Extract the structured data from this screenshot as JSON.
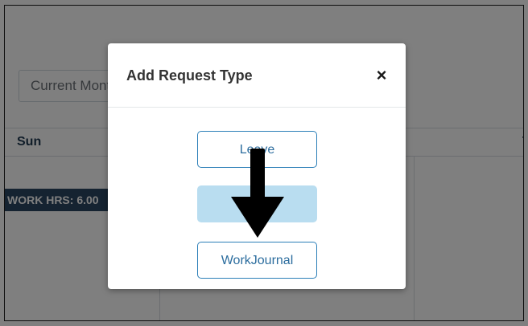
{
  "background": {
    "range_select_value": "Current Month",
    "calendar": {
      "days": [
        "Sun",
        "T"
      ]
    },
    "work_hrs_label": "WORK HRS: 6.00"
  },
  "modal": {
    "title": "Add Request Type",
    "close_symbol": "×",
    "buttons": [
      {
        "label": "Leave",
        "state": "enabled"
      },
      {
        "label": "",
        "state": "disabled"
      },
      {
        "label": "WorkJournal",
        "state": "enabled"
      }
    ]
  },
  "annotation": {
    "icon": "down-arrow-icon",
    "color": "#000000"
  },
  "colors": {
    "accent": "#2c7fb8",
    "header_bar": "#2a4663",
    "disabled_button": "#b9ddf0"
  }
}
